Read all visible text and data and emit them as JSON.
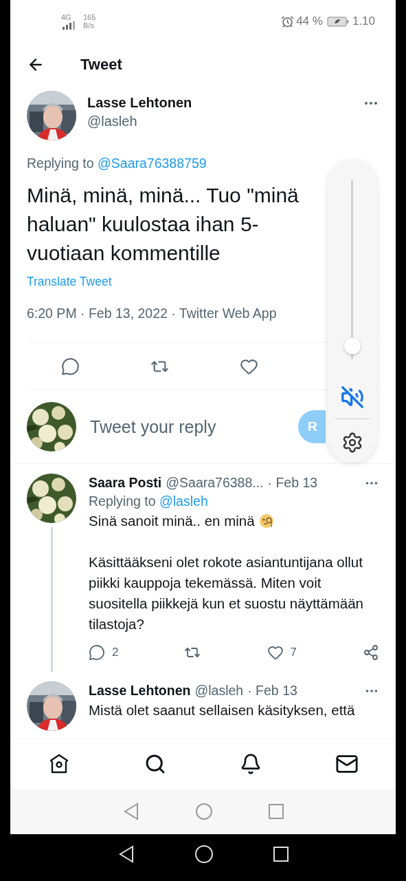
{
  "status_bar": {
    "network": "4G",
    "speed": "165",
    "speed_unit": "B/s",
    "battery": "44 %",
    "time": "1.10"
  },
  "header": {
    "title": "Tweet"
  },
  "tweet": {
    "author": "Lasse Lehtonen",
    "handle": "@lasleh",
    "replying_prefix": "Replying to",
    "replying_to": "@Saara76388759",
    "text": "Minä, minä, minä... Tuo \"minä haluan\" kuulostaa ihan 5-vuotiaan kommentille",
    "translate": "Translate Tweet",
    "meta": "6:20 PM · Feb 13, 2022 · Twitter Web App"
  },
  "compose": {
    "placeholder": "Tweet your reply",
    "button": "R"
  },
  "volume": {
    "level": 0.03,
    "muted": true
  },
  "replies": [
    {
      "author": "Saara Posti",
      "handle": "@Saara76388...",
      "date": "· Feb 13",
      "replying_prefix": "Replying to",
      "replying_to": "@lasleh",
      "thread": true,
      "paragraphs": [
        {
          "kind": "with-emoji",
          "text": "Sinä sanoit minä.. en minä"
        },
        {
          "kind": "plain",
          "text": "Käsittääkseni olet rokote asiantuntijana ollut piikki kauppoja tekemässä. Miten voit suositella piikkejä kun et suostu näyttämään tilastoja?"
        }
      ],
      "replies_count": "2",
      "likes": "7"
    },
    {
      "author": "Lasse Lehtonen",
      "handle": "@lasleh",
      "date": "· Feb 13",
      "thread": false,
      "paragraphs": [
        {
          "kind": "plain",
          "text": "Mistä olet saanut sellaisen käsityksen, että"
        }
      ]
    }
  ]
}
